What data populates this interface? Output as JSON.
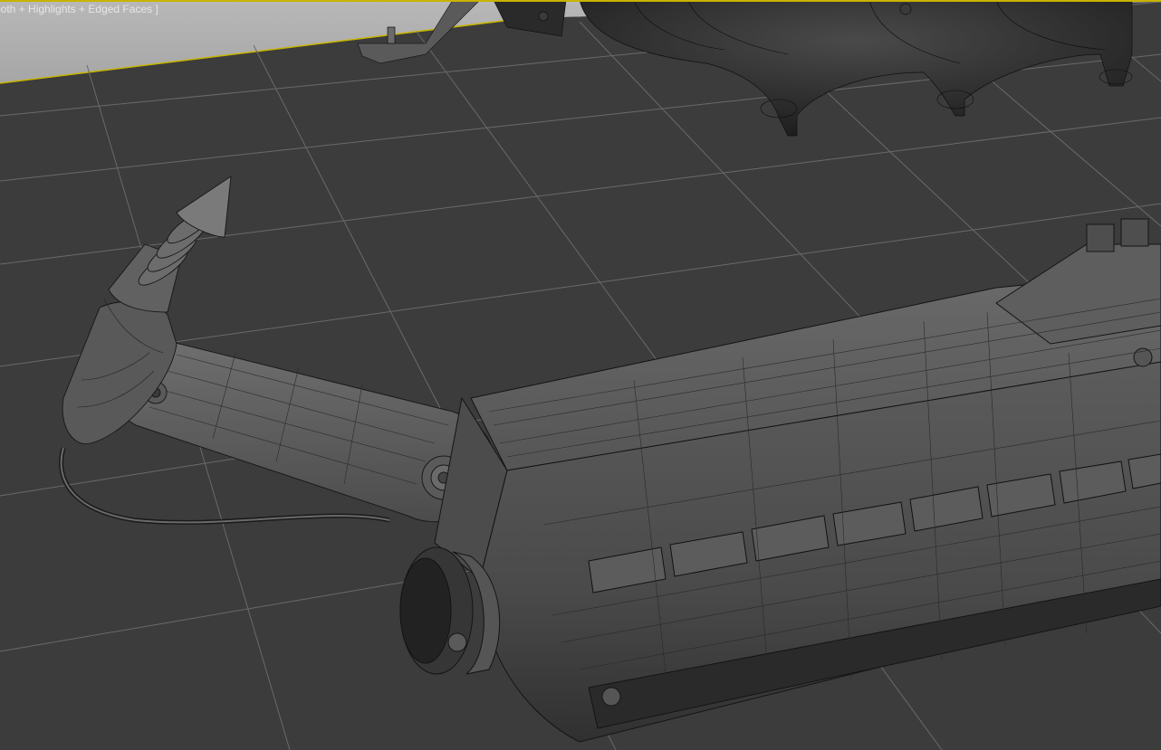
{
  "viewport": {
    "label": "ooth + Highlights + Edged Faces ]",
    "active_border_color": "#c8b400",
    "background_color": "#3b3b3b",
    "grid_color": "#6a6a6a",
    "sky_color": "#b4b4b4"
  }
}
